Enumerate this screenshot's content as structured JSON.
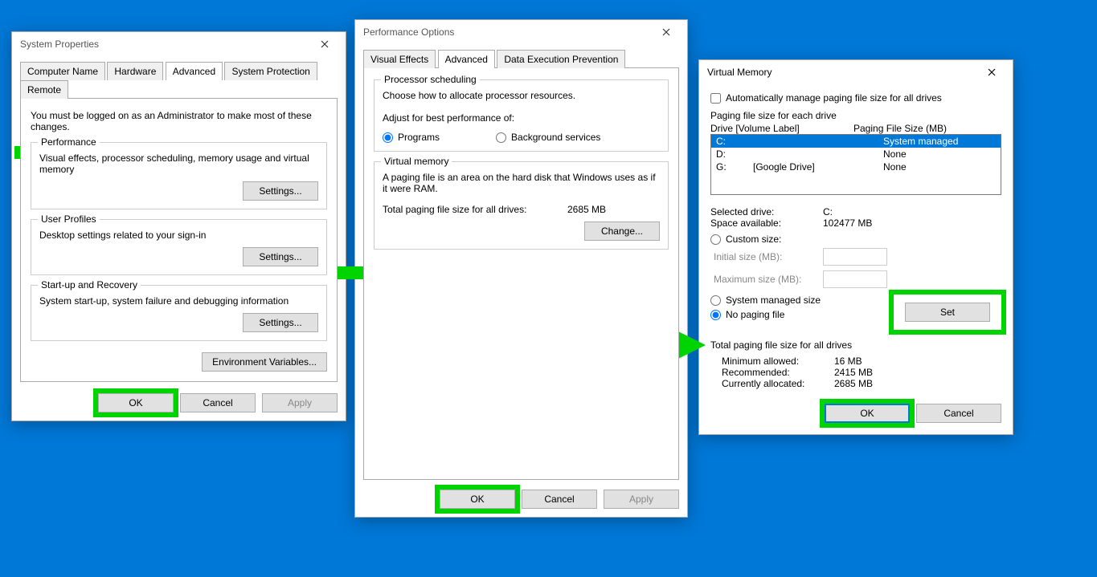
{
  "sysprop": {
    "title": "System Properties",
    "tabs": [
      "Computer Name",
      "Hardware",
      "Advanced",
      "System Protection",
      "Remote"
    ],
    "active_tab": 2,
    "admin_note": "You must be logged on as an Administrator to make most of these changes.",
    "perf": {
      "legend": "Performance",
      "desc": "Visual effects, processor scheduling, memory usage and virtual memory",
      "btn": "Settings..."
    },
    "user": {
      "legend": "User Profiles",
      "desc": "Desktop settings related to your sign-in",
      "btn": "Settings..."
    },
    "startup": {
      "legend": "Start-up and Recovery",
      "desc": "System start-up, system failure and debugging information",
      "btn": "Settings..."
    },
    "env_btn": "Environment Variables...",
    "ok": "OK",
    "cancel": "Cancel",
    "apply": "Apply"
  },
  "perfopt": {
    "title": "Performance Options",
    "tabs": [
      "Visual Effects",
      "Advanced",
      "Data Execution Prevention"
    ],
    "active_tab": 1,
    "proc": {
      "legend": "Processor scheduling",
      "desc": "Choose how to allocate processor resources.",
      "adjust": "Adjust for best performance of:",
      "r1": "Programs",
      "r2": "Background services"
    },
    "vm": {
      "legend": "Virtual memory",
      "desc": "A paging file is an area on the hard disk that Windows uses as if it were RAM.",
      "total_lbl": "Total paging file size for all drives:",
      "total_val": "2685 MB",
      "btn": "Change..."
    },
    "ok": "OK",
    "cancel": "Cancel",
    "apply": "Apply"
  },
  "vmem": {
    "title": "Virtual Memory",
    "auto": "Automatically manage paging file size for all drives",
    "each_drive": "Paging file size for each drive",
    "hdr_drive": "Drive  [Volume Label]",
    "hdr_size": "Paging File Size (MB)",
    "drives": [
      {
        "letter": "C:",
        "label": "",
        "size": "System managed",
        "sel": true
      },
      {
        "letter": "D:",
        "label": "",
        "size": "None",
        "sel": false
      },
      {
        "letter": "G:",
        "label": "[Google Drive]",
        "size": "None",
        "sel": false
      }
    ],
    "selected_lbl": "Selected drive:",
    "selected_val": "C:",
    "space_lbl": "Space available:",
    "space_val": "102477 MB",
    "custom": "Custom size:",
    "init_lbl": "Initial size (MB):",
    "max_lbl": "Maximum size (MB):",
    "sys_managed": "System managed size",
    "no_paging": "No paging file",
    "set": "Set",
    "totals_hdr": "Total paging file size for all drives",
    "min_lbl": "Minimum allowed:",
    "min_val": "16 MB",
    "rec_lbl": "Recommended:",
    "rec_val": "2415 MB",
    "cur_lbl": "Currently allocated:",
    "cur_val": "2685 MB",
    "ok": "OK",
    "cancel": "Cancel"
  }
}
